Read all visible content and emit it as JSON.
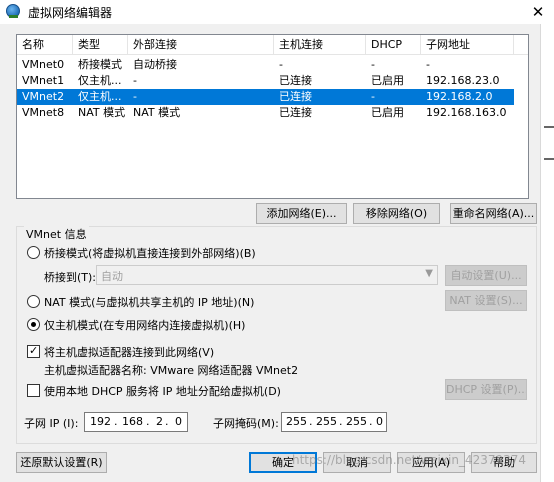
{
  "window": {
    "title": "虚拟网络编辑器",
    "close_glyph": "✕"
  },
  "list": {
    "headers": [
      "名称",
      "类型",
      "外部连接",
      "主机连接",
      "DHCP",
      "子网地址"
    ],
    "rows": [
      {
        "name": "VMnet0",
        "type": "桥接模式",
        "external": "自动桥接",
        "host": "-",
        "dhcp": "-",
        "subnet": "-",
        "selected": false
      },
      {
        "name": "VMnet1",
        "type": "仅主机...",
        "external": "-",
        "host": "已连接",
        "dhcp": "已启用",
        "subnet": "192.168.23.0",
        "selected": false
      },
      {
        "name": "VMnet2",
        "type": "仅主机...",
        "external": "-",
        "host": "已连接",
        "dhcp": "-",
        "subnet": "192.168.2.0",
        "selected": true
      },
      {
        "name": "VMnet8",
        "type": "NAT 模式",
        "external": "NAT 模式",
        "host": "已连接",
        "dhcp": "已启用",
        "subnet": "192.168.163.0",
        "selected": false
      }
    ]
  },
  "list_buttons": {
    "add": "添加网络(E)...",
    "remove": "移除网络(O)",
    "rename": "重命名网络(A)..."
  },
  "vmnet_info": {
    "title": "VMnet 信息",
    "bridged_label": "桥接模式(将虚拟机直接连接到外部网络)(B)",
    "bridge_to_label": "桥接到(T):",
    "bridge_to_value": "自动",
    "auto_settings": "自动设置(U)...",
    "nat_label": "NAT 模式(与虚拟机共享主机的 IP 地址)(N)",
    "nat_settings": "NAT 设置(S)...",
    "hostonly_label": "仅主机模式(在专用网络内连接虚拟机)(H)",
    "selected_mode": "hostonly",
    "connect_adapter_label": "将主机虚拟适配器连接到此网络(V)",
    "connect_adapter_checked": true,
    "adapter_name_label": "主机虚拟适配器名称: VMware 网络适配器 VMnet2",
    "dhcp_label": "使用本地 DHCP 服务将 IP 地址分配给虚拟机(D)",
    "dhcp_checked": false,
    "dhcp_settings": "DHCP 设置(P)...",
    "subnet_ip_label": "子网 IP (I):",
    "subnet_ip": [
      "192",
      "168",
      "2",
      "0"
    ],
    "subnet_mask_label": "子网掩码(M):",
    "subnet_mask": [
      "255",
      "255",
      "255",
      "0"
    ]
  },
  "footer": {
    "restore_defaults": "还原默认设置(R)",
    "ok": "确定",
    "cancel": "取消",
    "apply": "应用(A)",
    "help": "帮助"
  },
  "watermark": "https://blog.csdn.net/weixin_42379374"
}
